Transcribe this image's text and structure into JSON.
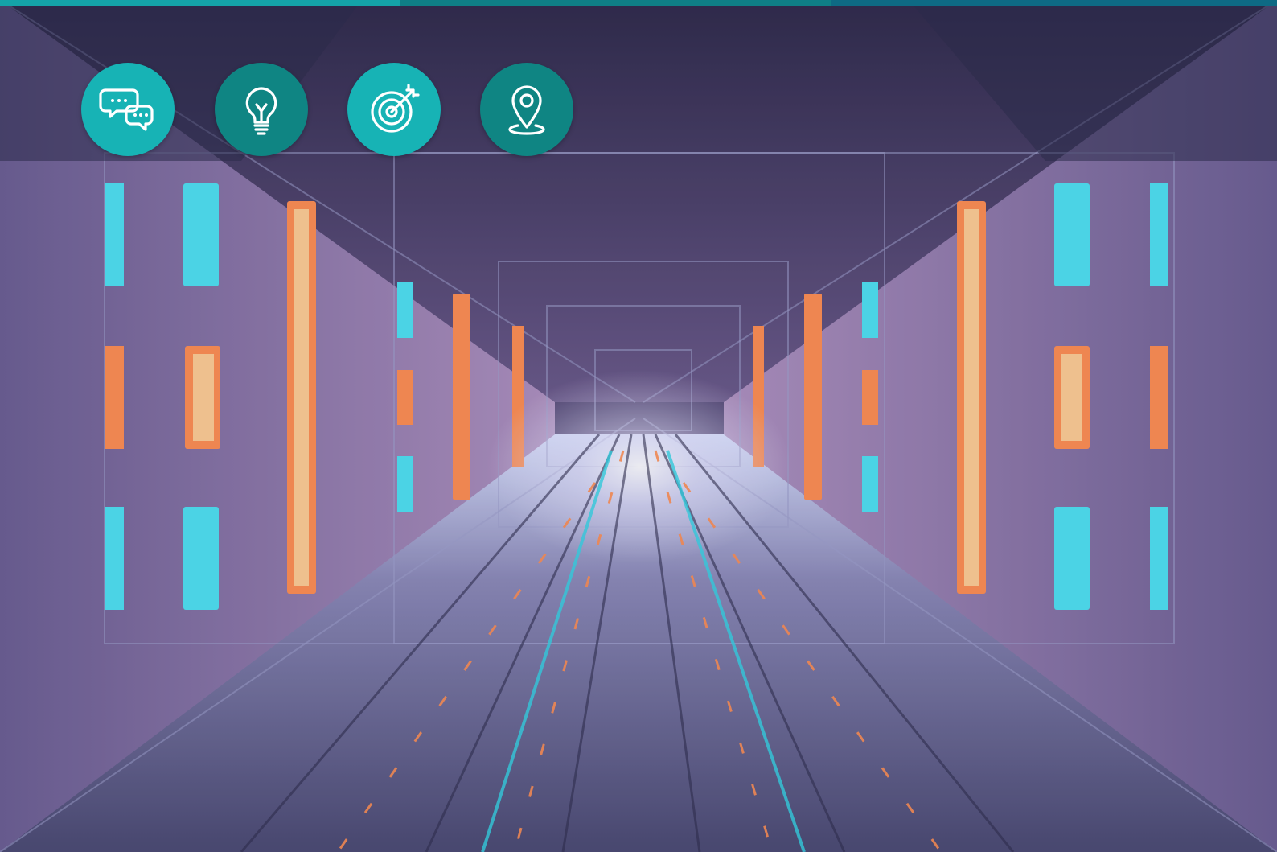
{
  "theme": {
    "bar_colors": [
      "#14a3a8",
      "#0f7f86",
      "#0e6a84"
    ],
    "icon_bg_light": "#17b3b5",
    "icon_bg_dark": "#0f8583",
    "icon_stroke": "#ffffff"
  },
  "icons": [
    {
      "name": "chat-bubbles-icon",
      "shade": "light"
    },
    {
      "name": "lightbulb-icon",
      "shade": "dark"
    },
    {
      "name": "target-icon",
      "shade": "light"
    },
    {
      "name": "location-pin-icon",
      "shade": "dark"
    }
  ]
}
